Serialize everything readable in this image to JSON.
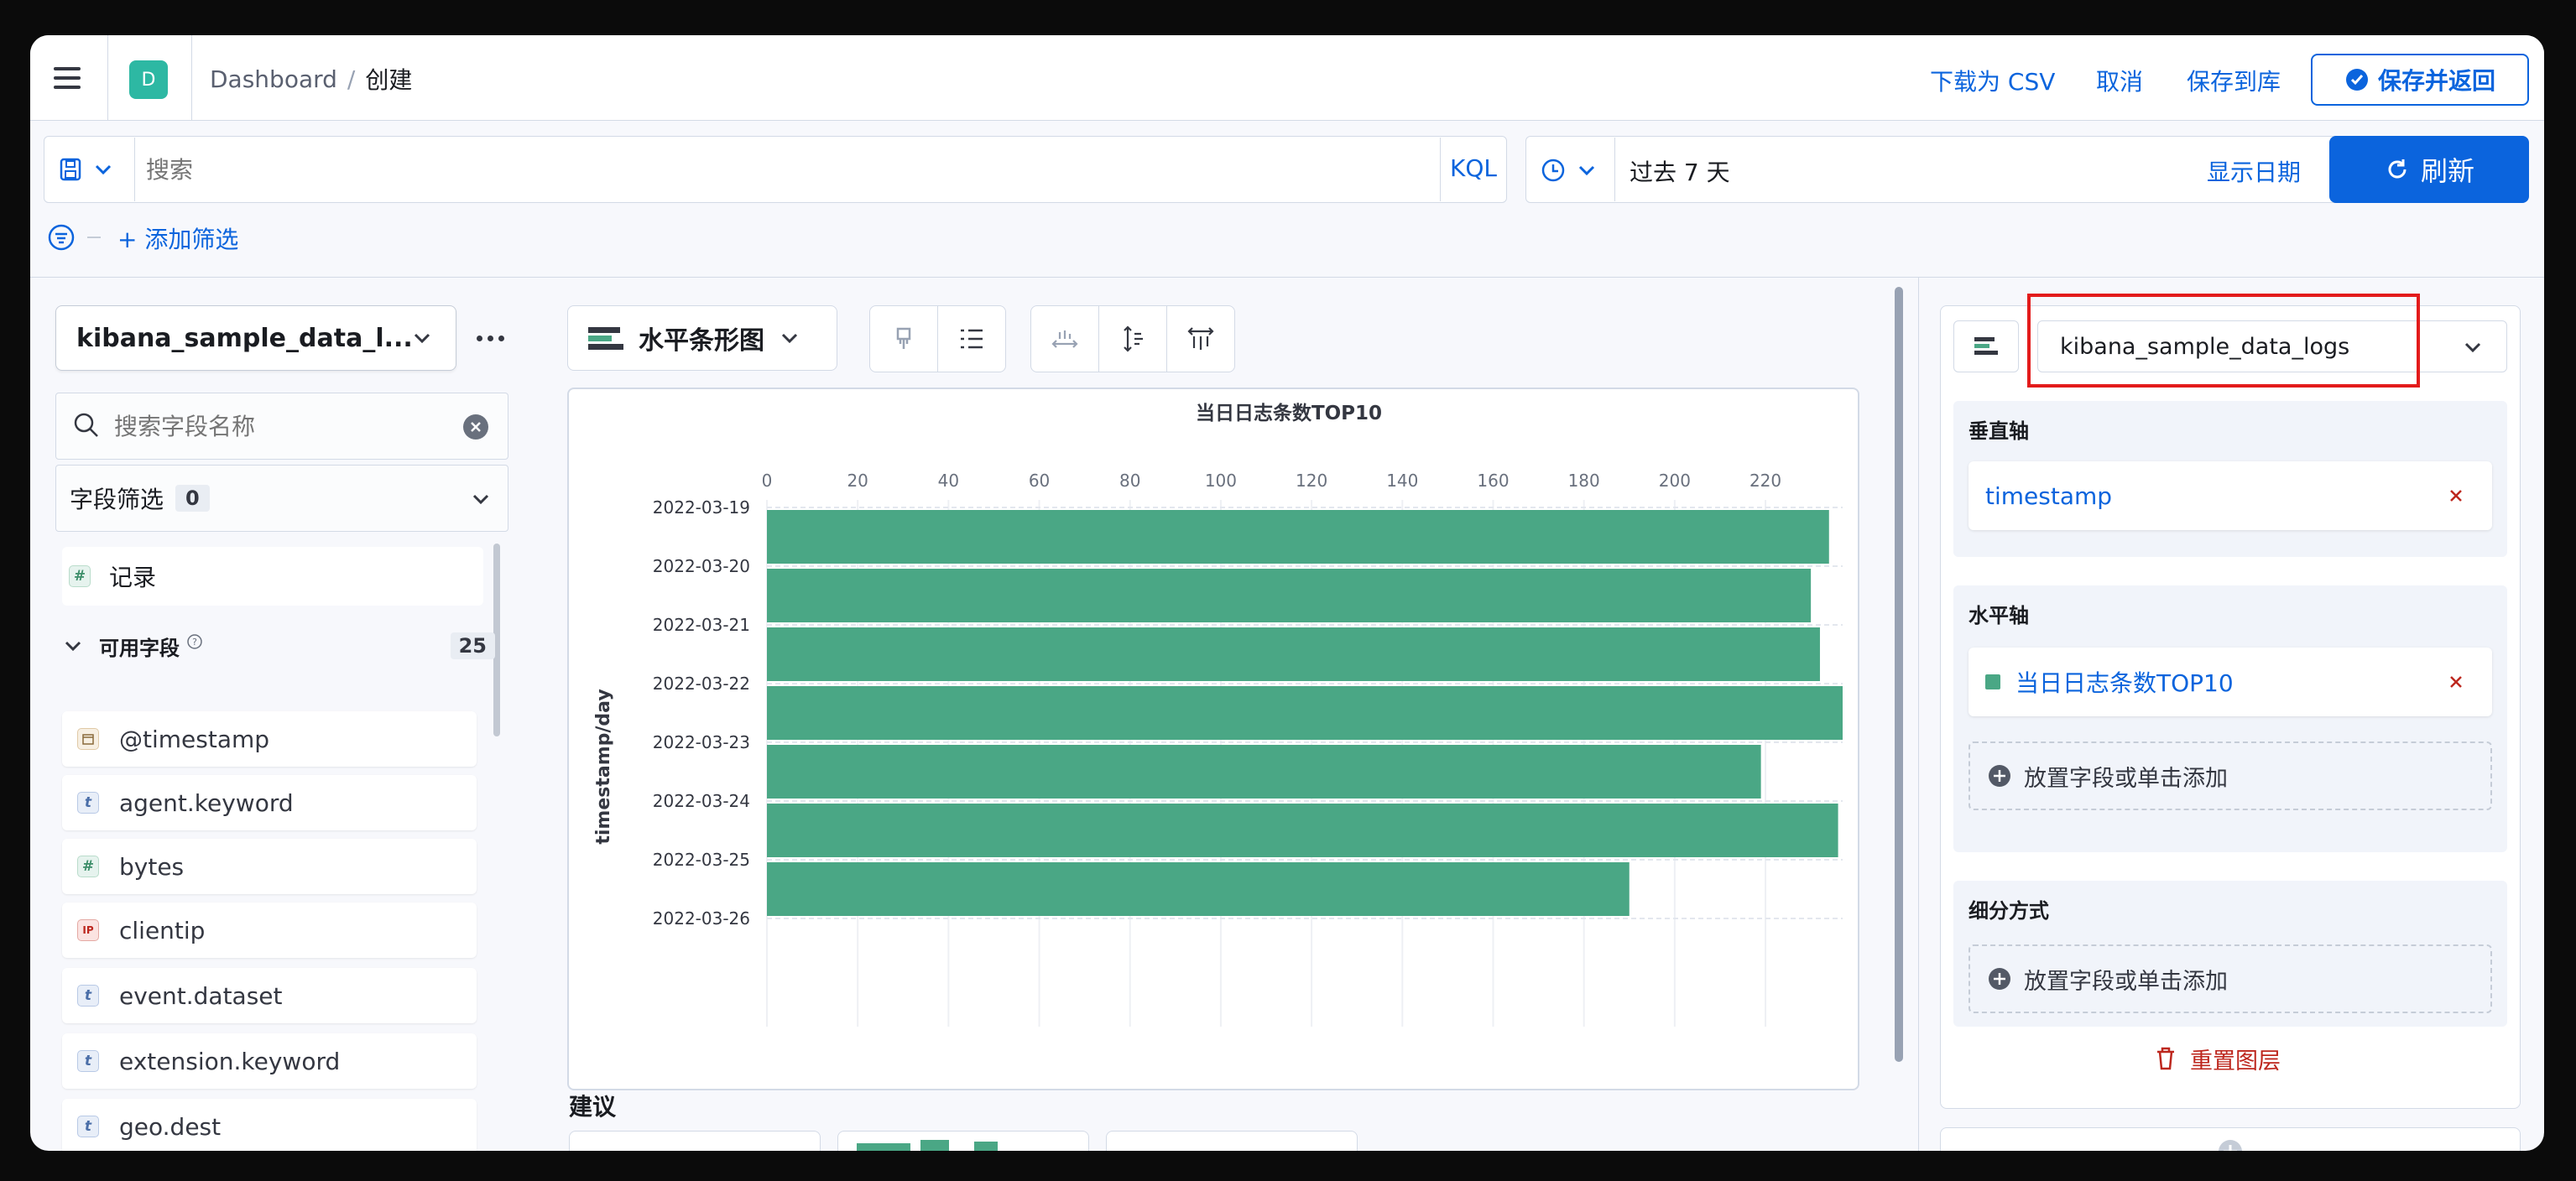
{
  "header": {
    "app_letter": "D",
    "breadcrumb": [
      "Dashboard",
      "创建"
    ],
    "download_csv": "下载为 CSV",
    "cancel": "取消",
    "save_to_library": "保存到库",
    "save_and_return": "保存并返回"
  },
  "query_bar": {
    "search_placeholder": "搜索",
    "language": "KQL",
    "time_range": "过去 7 天",
    "show_dates": "显示日期",
    "refresh": "刷新",
    "add_filter": "+ 添加筛选"
  },
  "sidebar": {
    "index_pattern": "kibana_sample_data_l...",
    "field_search_placeholder": "搜索字段名称",
    "field_filter_label": "字段筛选",
    "field_filter_count": "0",
    "records_label": "记录",
    "available_fields_label": "可用字段",
    "available_fields_count": "25",
    "fields": [
      {
        "name": "@timestamp",
        "type": "date"
      },
      {
        "name": "agent.keyword",
        "type": "string"
      },
      {
        "name": "bytes",
        "type": "number"
      },
      {
        "name": "clientip",
        "type": "ip"
      },
      {
        "name": "event.dataset",
        "type": "string"
      },
      {
        "name": "extension.keyword",
        "type": "string"
      },
      {
        "name": "geo.dest",
        "type": "string"
      }
    ]
  },
  "workspace": {
    "chart_type_label": "水平条形图",
    "suggestions_label": "建议"
  },
  "chart_data": {
    "type": "bar",
    "orientation": "horizontal",
    "title": "当日日志条数TOP10",
    "ylabel": "timestamp/day",
    "xlabel": "",
    "xlim": [
      0,
      237
    ],
    "xticks": [
      0,
      20,
      40,
      60,
      80,
      100,
      120,
      140,
      160,
      180,
      200,
      220
    ],
    "categories": [
      "2022-03-19",
      "2022-03-20",
      "2022-03-21",
      "2022-03-22",
      "2022-03-23",
      "2022-03-24",
      "2022-03-25",
      "2022-03-26"
    ],
    "values": [
      234,
      230,
      232,
      237,
      219,
      236,
      190,
      null
    ],
    "color": "#4aa785",
    "grid": true
  },
  "config_panel": {
    "layer_index": "kibana_sample_data_logs",
    "vertical_axis_label": "垂直轴",
    "vertical_axis_field": "timestamp",
    "horizontal_axis_label": "水平轴",
    "horizontal_axis_field": "当日日志条数TOP10",
    "drop_field_text": "放置字段或单击添加",
    "breakdown_label": "细分方式",
    "breakdown_drop_text": "放置字段或单击添加",
    "reset_layer": "重置图层"
  },
  "colors": {
    "accent": "#0b64dd",
    "bar": "#4aa785",
    "danger": "#bd271e",
    "highlight_box": "#e31b1b"
  }
}
